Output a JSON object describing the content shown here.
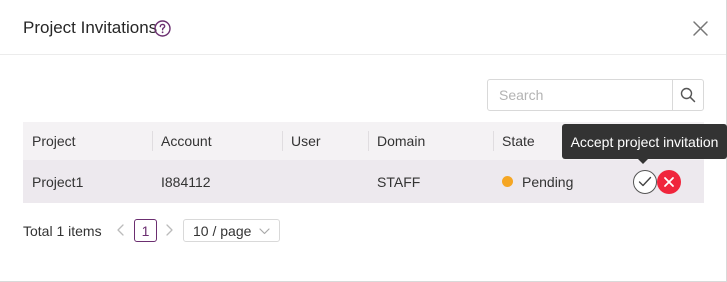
{
  "dialog": {
    "title": "Project Invitations"
  },
  "search": {
    "placeholder": "Search"
  },
  "table": {
    "columns": [
      "Project",
      "Account",
      "User",
      "Domain",
      "State"
    ],
    "rows": [
      {
        "project": "Project1",
        "account": "I884112",
        "user": "",
        "domain": "STAFF",
        "state": "Pending",
        "state_color": "#f5a623"
      }
    ]
  },
  "tooltip": {
    "text": "Accept project invitation"
  },
  "pagination": {
    "total": "Total 1 items",
    "current_page": "1",
    "page_size": "10 / page"
  },
  "colors": {
    "accent": "#6b2e70",
    "reject": "#f0253c",
    "pending": "#f5a623"
  }
}
